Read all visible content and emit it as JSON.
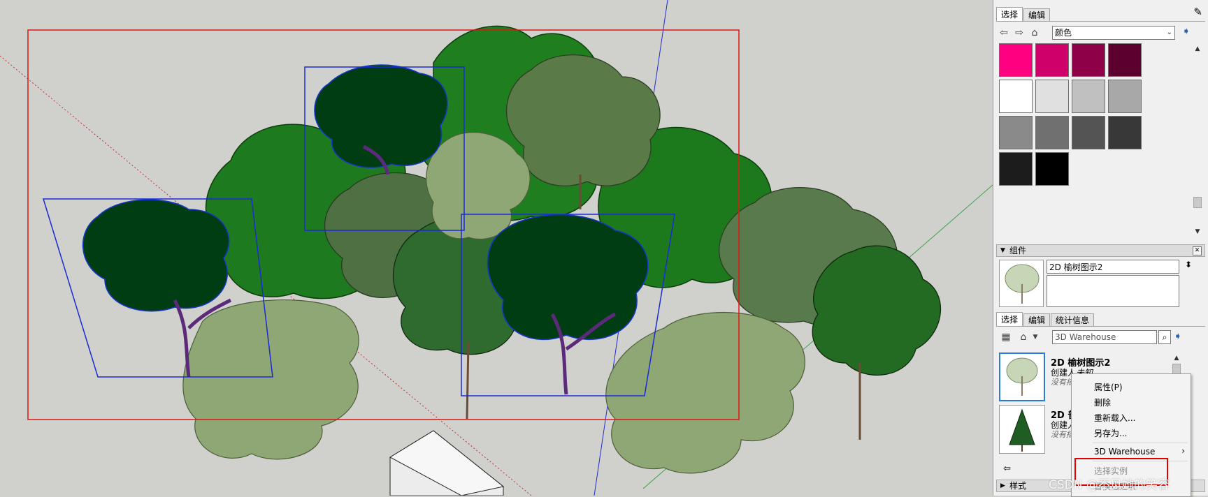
{
  "viewport": {
    "description_icon": "3d-model-canvas"
  },
  "materials": {
    "tabs": [
      "选择",
      "编辑"
    ],
    "active_tab": 0,
    "library_value": "颜色",
    "swatches": [
      "#ff0080",
      "#d0006a",
      "#8e0048",
      "#5c0030",
      "#ffffff",
      "#e0e0e0",
      "#c0c0c0",
      "#a8a8a8",
      "#8a8a8a",
      "#707070",
      "#545454",
      "#383838",
      "#1c1c1c",
      "#000000"
    ]
  },
  "components": {
    "header": "组件",
    "name_value": "2D 榆树图示2",
    "description_value": "",
    "tabs": [
      "选择",
      "编辑",
      "统计信息"
    ],
    "active_tab": 0,
    "search_value": "3D Warehouse",
    "items": [
      {
        "title": "2D 榆树图示2",
        "creator": "创建人",
        "creator_value": "未知",
        "desc": "没有描"
      },
      {
        "title": "2D 普",
        "creator": "创建人",
        "creator_value": "",
        "desc": "没有描"
      }
    ]
  },
  "context_menu": {
    "items": [
      {
        "label": "属性(P)",
        "disabled": false
      },
      {
        "label": "删除",
        "disabled": false
      },
      {
        "label": "重新载入...",
        "disabled": false
      },
      {
        "label": "另存为...",
        "disabled": false
      },
      {
        "label": "3D Warehouse",
        "disabled": false,
        "submenu": true
      },
      {
        "label": "选择实例",
        "disabled": true
      },
      {
        "label": "替换选定项",
        "disabled": true
      }
    ]
  },
  "styles": {
    "header": "样式"
  },
  "watermark": "CSDN @不见她的笑容"
}
